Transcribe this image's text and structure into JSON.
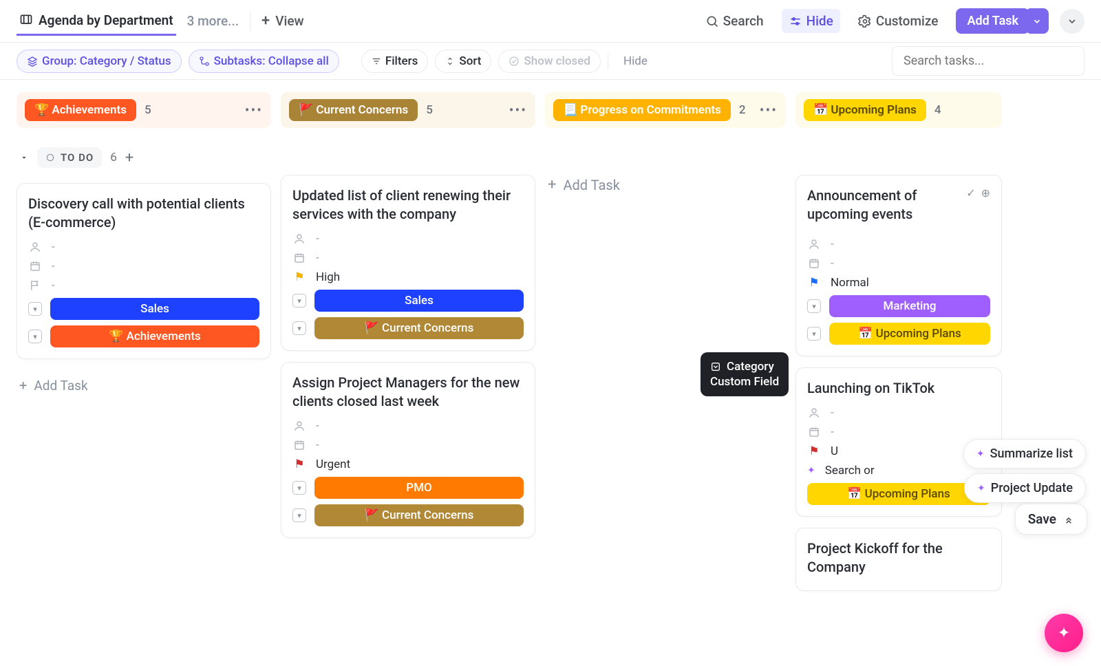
{
  "topnav": {
    "view_name": "Agenda by Department",
    "more": "3 more...",
    "add_view": "View",
    "search": "Search",
    "hide": "Hide",
    "customize": "Customize",
    "add_task": "Add Task"
  },
  "filters": {
    "group": "Group: Category / Status",
    "subtasks": "Subtasks: Collapse all",
    "filters_label": "Filters",
    "sort_label": "Sort",
    "show_closed": "Show closed",
    "hide": "Hide",
    "search_placeholder": "Search tasks..."
  },
  "tooltip": {
    "line1": "Category",
    "line2": "Custom Field"
  },
  "status": {
    "label": "TO DO",
    "count": "6"
  },
  "lanes": [
    {
      "chip": "🏆 Achievements",
      "count": "5",
      "color": "#ff5722",
      "bg": "orange-bg"
    },
    {
      "chip": "🚩 Current Concerns",
      "count": "5",
      "color": "#a98336",
      "bg": "brown-bg"
    },
    {
      "chip": "📃 Progress on Commitments",
      "count": "2",
      "color": "#ffb300",
      "bg": "yellow-bg"
    },
    {
      "chip": "📅 Upcoming Plans",
      "count": "4",
      "color": "#ffd600",
      "bg": "yellow2-bg",
      "chip_text_dark": true
    }
  ],
  "cards": {
    "lane0": [
      {
        "title": "Discovery call with potential clients (E-commerce)",
        "assignee": "-",
        "date": "-",
        "flag": "-",
        "badges": [
          {
            "text": "Sales",
            "cls": "blue"
          },
          {
            "text": "🏆 Achievements",
            "cls": "orange"
          }
        ]
      }
    ],
    "lane1": [
      {
        "title": "Updated list of client renewing their services with the company",
        "assignee": "-",
        "date": "-",
        "flag": "High",
        "flag_cls": "yellowf",
        "badges": [
          {
            "text": "Sales",
            "cls": "blue"
          },
          {
            "text": "🚩 Current Concerns",
            "cls": "brown"
          }
        ]
      },
      {
        "title": "Assign Project Managers for the new clients closed last week",
        "assignee": "-",
        "date": "-",
        "flag": "Urgent",
        "flag_cls": "redf",
        "badges": [
          {
            "text": "PMO",
            "cls": "orange2"
          },
          {
            "text": "🚩 Current Concerns",
            "cls": "brown"
          }
        ]
      }
    ],
    "lane3": [
      {
        "title": "Announcement of upcoming events",
        "assignee": "-",
        "date": "-",
        "flag": "Normal",
        "flag_cls": "bluef",
        "badges": [
          {
            "text": "Marketing",
            "cls": "purple"
          },
          {
            "text": "📅 Upcoming Plans",
            "cls": "yellow"
          }
        ]
      },
      {
        "title": "Launching on TikTok",
        "assignee": "-",
        "date": "-",
        "flag": "U",
        "flag_cls": "redf",
        "search_or": "Search or",
        "badges": [
          {
            "text": "",
            "cls": "purple"
          },
          {
            "text": "📅 Upcoming Plans",
            "cls": "yellow"
          }
        ]
      },
      {
        "title": "Project Kickoff for the Company"
      }
    ]
  },
  "add_task_label": "Add Task",
  "ai": {
    "summarize": "Summarize list",
    "project_update": "Project Update",
    "save": "Save"
  }
}
